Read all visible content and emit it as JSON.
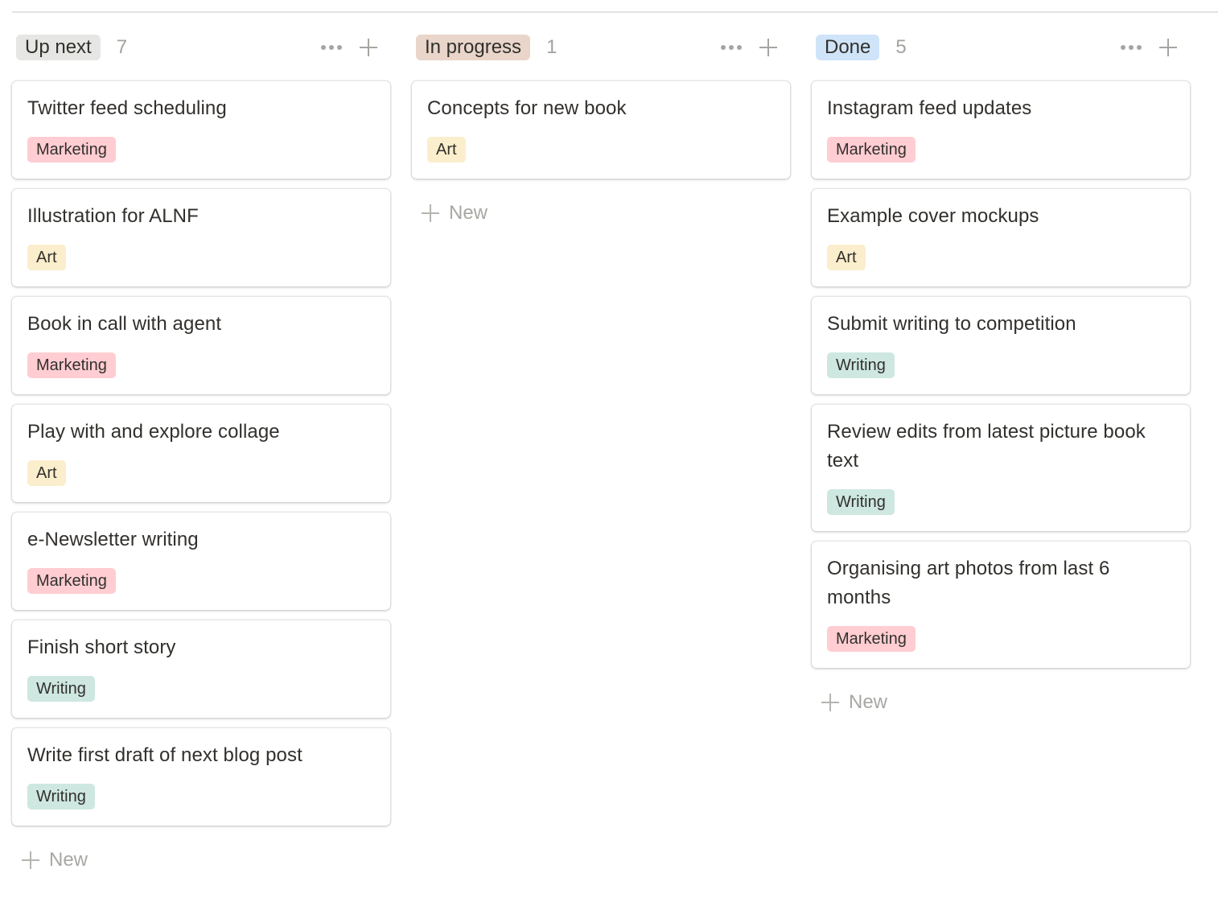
{
  "colors": {
    "up_next_bg": "#e6e6e4",
    "in_progress_bg": "#e9d5ca",
    "done_bg": "#cfe4f9",
    "tag_marketing": "#ffcdd2",
    "tag_art": "#fbeecc",
    "tag_writing": "#cee7e1"
  },
  "columns": [
    {
      "title": "Up next",
      "count": "7",
      "more_icon": "ellipsis-icon",
      "add_icon": "plus-icon",
      "new_label": "New",
      "cards": [
        {
          "title": "Twitter feed scheduling",
          "tag": "Marketing"
        },
        {
          "title": "Illustration for ALNF",
          "tag": "Art"
        },
        {
          "title": "Book in call with agent",
          "tag": "Marketing"
        },
        {
          "title": "Play with and explore collage",
          "tag": "Art"
        },
        {
          "title": "e-Newsletter writing",
          "tag": "Marketing"
        },
        {
          "title": "Finish short story",
          "tag": "Writing"
        },
        {
          "title": "Write first draft of next blog post",
          "tag": "Writing"
        }
      ]
    },
    {
      "title": "In progress",
      "count": "1",
      "more_icon": "ellipsis-icon",
      "add_icon": "plus-icon",
      "new_label": "New",
      "cards": [
        {
          "title": "Concepts for new book",
          "tag": "Art"
        }
      ]
    },
    {
      "title": "Done",
      "count": "5",
      "more_icon": "ellipsis-icon",
      "add_icon": "plus-icon",
      "new_label": "New",
      "cards": [
        {
          "title": "Instagram feed updates",
          "tag": "Marketing"
        },
        {
          "title": "Example cover mockups",
          "tag": "Art"
        },
        {
          "title": "Submit writing to competition",
          "tag": "Writing"
        },
        {
          "title": "Review edits from latest picture book text",
          "tag": "Writing"
        },
        {
          "title": "Organising art photos from last 6 months",
          "tag": "Marketing"
        }
      ]
    }
  ]
}
